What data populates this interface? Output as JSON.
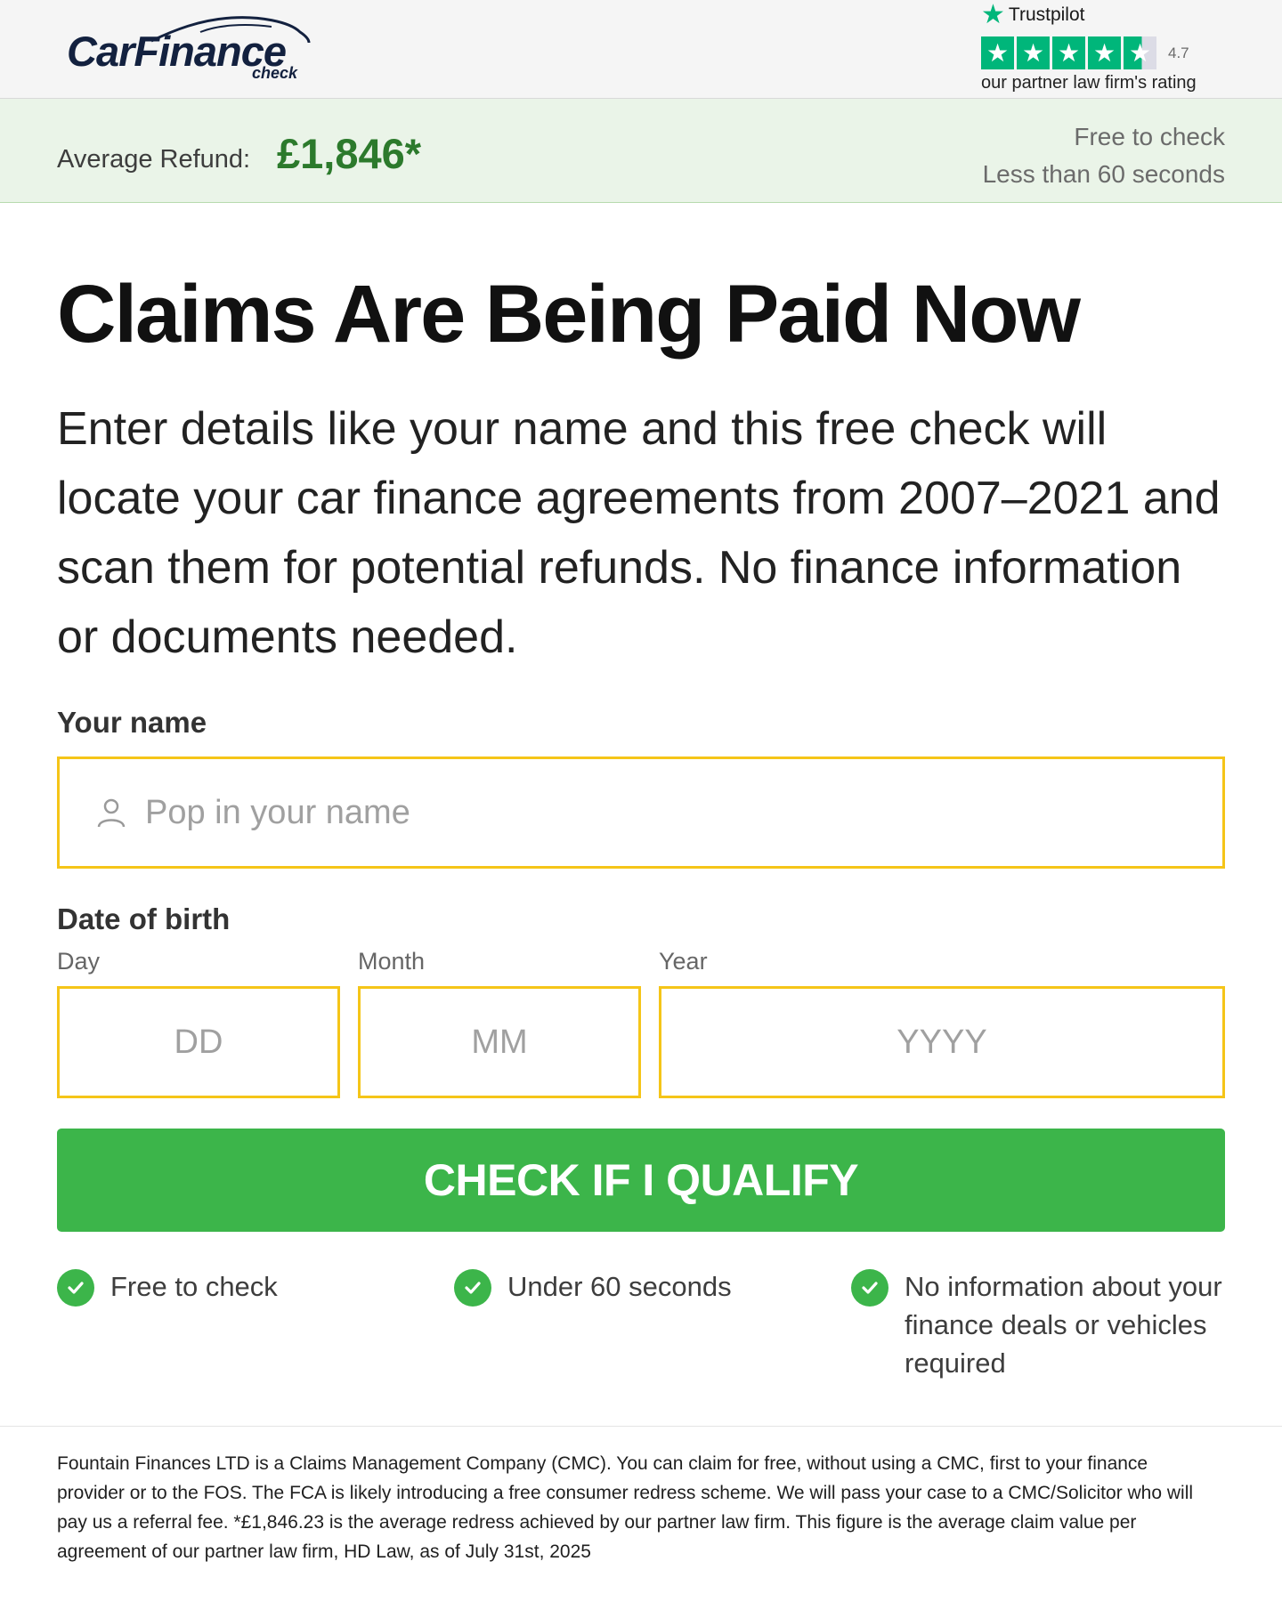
{
  "brand": {
    "logo_main": "CarFinance",
    "logo_sub": "check",
    "colors": {
      "navy": "#13213f",
      "green": "#3cb54a",
      "dark_green": "#2c7a2c",
      "yellow_border": "#f5c518",
      "trustpilot_green": "#00b67a"
    }
  },
  "trustpilot": {
    "name": "Trustpilot",
    "score": "4.7",
    "caption": "our partner law firm's rating",
    "stars": 4.5
  },
  "refund_bar": {
    "label": "Average Refund:",
    "value": "£1,846*",
    "right_line1": "Free to check",
    "right_line2": "Less than 60 seconds"
  },
  "main": {
    "headline": "Claims Are Being Paid Now",
    "intro": "Enter details like your name and this free check will locate your car finance agreements from 2007–2021 and scan them for potential refunds. No finance information or documents needed."
  },
  "form": {
    "name_label": "Your name",
    "name_placeholder": "Pop in your name",
    "dob_label": "Date of birth",
    "day_label": "Day",
    "day_placeholder": "DD",
    "month_label": "Month",
    "month_placeholder": "MM",
    "year_label": "Year",
    "year_placeholder": "YYYY",
    "submit_label": "CHECK IF I QUALIFY"
  },
  "benefits": [
    {
      "text": "Free to check",
      "icon": "check-icon"
    },
    {
      "text": "Under 60 seconds",
      "icon": "check-icon"
    },
    {
      "text": "No information about your finance deals or vehicles required",
      "icon": "check-icon"
    }
  ],
  "footer": {
    "disclaimer": "Fountain Finances LTD is a Claims Management Company (CMC). You can claim for free, without using a CMC, first to your finance provider or to the FOS. The FCA is likely introducing a free consumer redress scheme. We will pass your case to a CMC/Solicitor who will pay us a referral fee. *£1,846.23 is the average redress achieved by our partner law firm. This figure is the average claim value per agreement of our partner law firm, HD Law, as of July 31st, 2025"
  }
}
